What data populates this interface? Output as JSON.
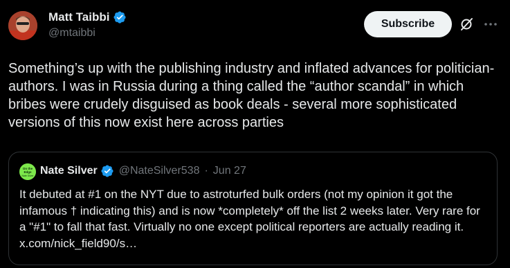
{
  "author": {
    "name": "Matt Taibbi",
    "handle": "@mtaibbi"
  },
  "actions": {
    "subscribe_label": "Subscribe",
    "grok_icon": "grok-slash-icon",
    "more_icon": "ellipsis-icon"
  },
  "tweet": {
    "text": "Something’s up with the publishing industry and inflated advances for politician-authors. I was in Russia during a thing called the “author scandal” in which bribes were crudely disguised as book deals - several more sophisticated versions of this now exist here across parties"
  },
  "quote": {
    "name": "Nate Silver",
    "handle": "@NateSilver538",
    "separator": "·",
    "date": "Jun 27",
    "avatar_text": "On the Edge · Nate Silver",
    "text": "It debuted at #1 on the NYT due to astroturfed bulk orders (not my opinion it got the infamous † indicating this) and is now *completely* off the list 2 weeks later. Very rare for a \"#1\" to fall that fast. Virtually no one except political reporters are actually reading it. x.com/nick_field90/s…"
  },
  "colors": {
    "background": "#000000",
    "text": "#e7e9ea",
    "muted": "#71767b",
    "verified": "#1d9bf0",
    "border": "#2f3336"
  }
}
